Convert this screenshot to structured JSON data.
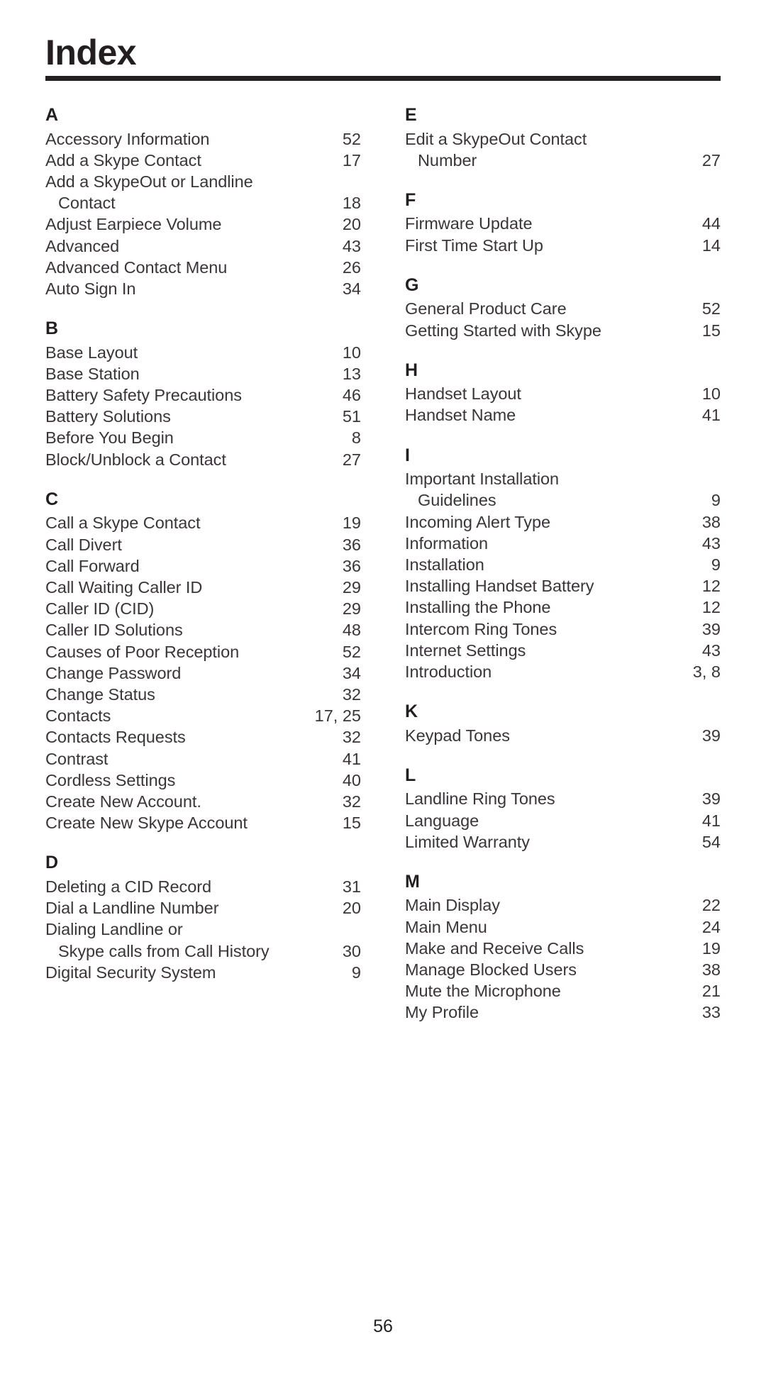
{
  "document": {
    "title": "Index",
    "folio": "56"
  },
  "columns": [
    {
      "name": "left-column",
      "sections": [
        {
          "letter": "A",
          "entries": [
            {
              "label": "Accessory Information",
              "page": "52"
            },
            {
              "label": "Add a Skype Contact",
              "page": "17"
            },
            {
              "label": "Add a SkypeOut or Landline",
              "page": ""
            },
            {
              "label": "Contact",
              "page": "18",
              "continuation": true
            },
            {
              "label": "Adjust Earpiece Volume",
              "page": "20"
            },
            {
              "label": "Advanced",
              "page": "43"
            },
            {
              "label": "Advanced Contact Menu",
              "page": "26"
            },
            {
              "label": "Auto Sign In",
              "page": "34"
            }
          ]
        },
        {
          "letter": "B",
          "entries": [
            {
              "label": "Base Layout",
              "page": "10"
            },
            {
              "label": "Base Station",
              "page": "13"
            },
            {
              "label": "Battery Safety Precautions",
              "page": "46"
            },
            {
              "label": "Battery Solutions",
              "page": "51"
            },
            {
              "label": "Before You Begin",
              "page": "8"
            },
            {
              "label": "Block/Unblock a Contact",
              "page": "27"
            }
          ]
        },
        {
          "letter": "C",
          "entries": [
            {
              "label": "Call a Skype Contact",
              "page": "19"
            },
            {
              "label": "Call Divert",
              "page": "36"
            },
            {
              "label": "Call Forward",
              "page": "36"
            },
            {
              "label": "Call Waiting Caller ID",
              "page": "29"
            },
            {
              "label": "Caller ID (CID)",
              "page": "29"
            },
            {
              "label": "Caller ID Solutions",
              "page": "48"
            },
            {
              "label": "Causes of Poor Reception",
              "page": "52"
            },
            {
              "label": "Change Password",
              "page": "34"
            },
            {
              "label": "Change Status",
              "page": "32"
            },
            {
              "label": "Contacts",
              "page": "17, 25"
            },
            {
              "label": "Contacts Requests",
              "page": "32"
            },
            {
              "label": "Contrast",
              "page": "41"
            },
            {
              "label": "Cordless Settings",
              "page": "40"
            },
            {
              "label": "Create New Account.",
              "page": "32"
            },
            {
              "label": "Create New Skype Account",
              "page": "15",
              "tight": true
            }
          ]
        },
        {
          "letter": "D",
          "entries": [
            {
              "label": "Deleting a CID Record",
              "page": "31"
            },
            {
              "label": "Dial a Landline Number",
              "page": "20"
            },
            {
              "label": "Dialing Landline or",
              "page": ""
            },
            {
              "label": "Skype calls from Call History",
              "page": "30",
              "continuation": true,
              "tight": true
            },
            {
              "label": "Digital Security System",
              "page": "9"
            }
          ]
        }
      ]
    },
    {
      "name": "right-column",
      "sections": [
        {
          "letter": "E",
          "entries": [
            {
              "label": "Edit a SkypeOut Contact",
              "page": ""
            },
            {
              "label": "Number",
              "page": "27",
              "continuation": true
            }
          ]
        },
        {
          "letter": "F",
          "entries": [
            {
              "label": "Firmware Update",
              "page": "44"
            },
            {
              "label": "First Time Start Up",
              "page": "14"
            }
          ]
        },
        {
          "letter": "G",
          "entries": [
            {
              "label": "General Product Care",
              "page": "52"
            },
            {
              "label": "Getting Started with Skype",
              "page": "15",
              "tight": true
            }
          ]
        },
        {
          "letter": "H",
          "entries": [
            {
              "label": "Handset Layout",
              "page": "10"
            },
            {
              "label": "Handset Name",
              "page": "41"
            }
          ]
        },
        {
          "letter": "I",
          "entries": [
            {
              "label": "Important Installation",
              "page": ""
            },
            {
              "label": "Guidelines",
              "page": "9",
              "continuation": true
            },
            {
              "label": "Incoming Alert Type",
              "page": "38"
            },
            {
              "label": "Information",
              "page": "43"
            },
            {
              "label": "Installation",
              "page": "9"
            },
            {
              "label": "Installing Handset Battery",
              "page": "12"
            },
            {
              "label": "Installing the Phone",
              "page": "12"
            },
            {
              "label": "Intercom Ring Tones",
              "page": "39"
            },
            {
              "label": "Internet Settings",
              "page": "43"
            },
            {
              "label": "Introduction",
              "page": "3, 8"
            }
          ]
        },
        {
          "letter": "K",
          "entries": [
            {
              "label": "Keypad Tones",
              "page": "39"
            }
          ]
        },
        {
          "letter": "L",
          "entries": [
            {
              "label": "Landline Ring Tones",
              "page": "39"
            },
            {
              "label": "Language",
              "page": "41"
            },
            {
              "label": "Limited Warranty",
              "page": "54"
            }
          ]
        },
        {
          "letter": "M",
          "entries": [
            {
              "label": "Main Display",
              "page": "22"
            },
            {
              "label": "Main Menu",
              "page": "24"
            },
            {
              "label": "Make and Receive Calls",
              "page": "19"
            },
            {
              "label": "Manage Blocked Users",
              "page": "38"
            },
            {
              "label": "Mute the Microphone",
              "page": "21"
            },
            {
              "label": "My Profile",
              "page": "33"
            }
          ]
        }
      ]
    }
  ]
}
